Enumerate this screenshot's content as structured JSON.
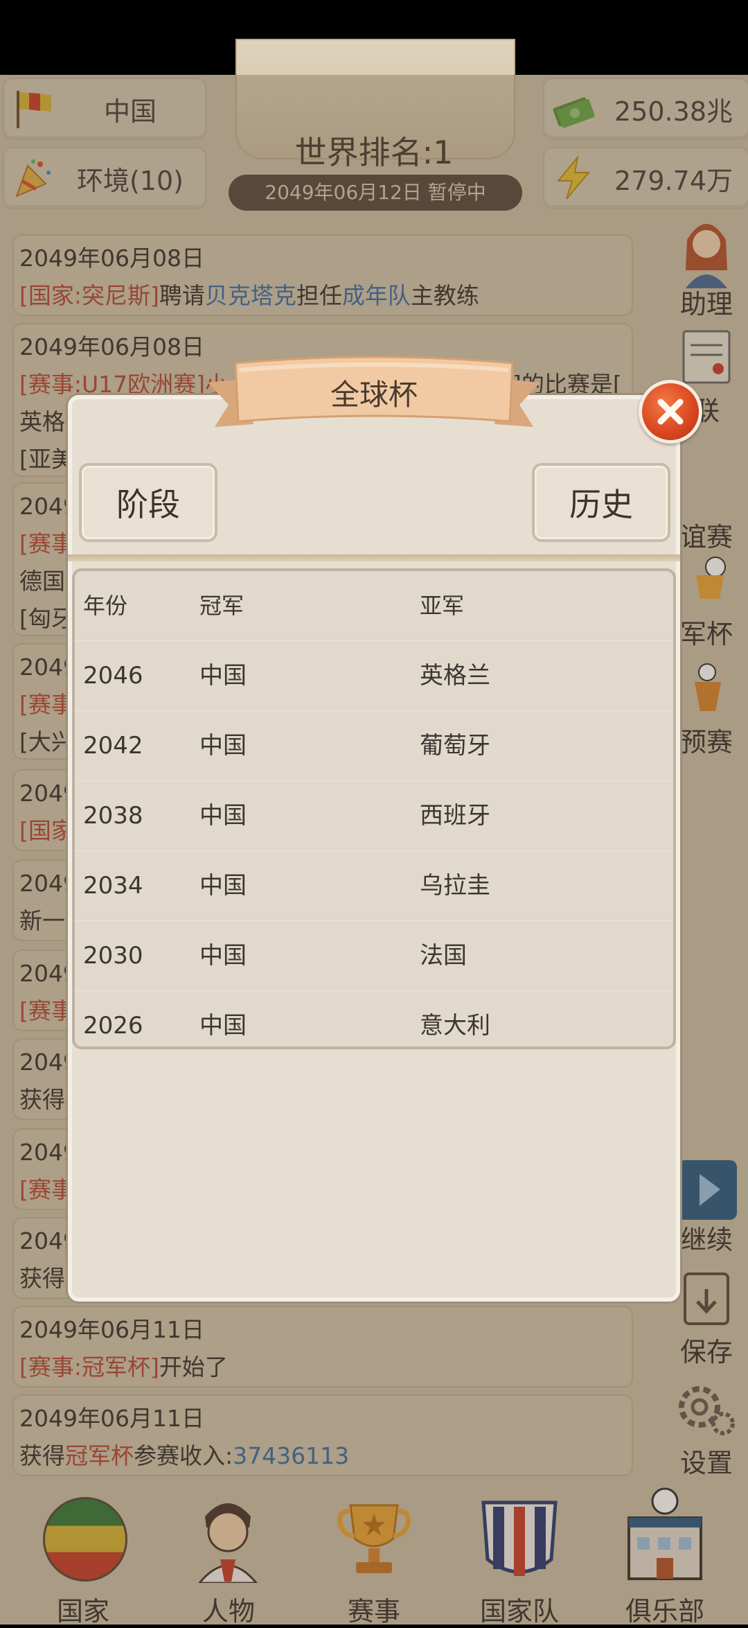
{
  "topbar": {
    "country": "中国",
    "environment": "环境(10)",
    "rank": "世界排名:1",
    "date_status": "2049年06月12日 暂停中",
    "money": "250.38兆",
    "energy": "279.74万"
  },
  "news": [
    {
      "date": "2049年06月08日",
      "line2": "[国家:突尼斯]聘请贝克塔克担任成年队主教练"
    },
    {
      "date": "2049年06月08日",
      "line2": "[赛事:U17欧洲赛]小",
      "line2b": "]的比赛是[",
      "line3": "英格",
      "line4": "[亚美"
    },
    {
      "date": "2049",
      "line2": "[赛事",
      "line3": "德国",
      "line4": "[匈牙"
    },
    {
      "date": "2049",
      "line2": "[赛事",
      "line3": "[大兴"
    },
    {
      "date": "2049",
      "line2": "[国家"
    },
    {
      "date": "2049",
      "line2": "新一"
    },
    {
      "date": "2049",
      "line2": "[赛事"
    },
    {
      "date": "2049",
      "line2": "获得"
    },
    {
      "date": "2049",
      "line2": "[赛事"
    },
    {
      "date": "2049",
      "line2": "获得"
    },
    {
      "date": "2049年06月11日",
      "line2_red": "[赛事:冠军杯]",
      "line2_rest": "开始了"
    },
    {
      "date": "2049年06月11日",
      "line2_a": "获得",
      "line2_red": "冠军杯",
      "line2_b": "参赛收入:",
      "line2_blue": "37436113"
    }
  ],
  "news_fragments": {
    "n1_country": "[国家:突尼斯]",
    "n1_a": "聘请",
    "n1_person": "贝克塔克",
    "n1_b": "担任",
    "n1_team": "成年队",
    "n1_c": "主教练"
  },
  "side": {
    "assistant": "助理",
    "friendly_partial": "谊赛",
    "cup_partial": "军杯",
    "qual_partial": "预赛",
    "continue_partial": "继续",
    "save": "保存",
    "settings": "设置",
    "top_partial": "联"
  },
  "nav": {
    "country": "国家",
    "people": "人物",
    "events": "赛事",
    "national_team": "国家队",
    "club": "俱乐部"
  },
  "dialog": {
    "title": "全球杯",
    "tab_stage": "阶段",
    "tab_history": "历史",
    "headers": [
      "年份",
      "冠军",
      "亚军"
    ],
    "rows": [
      [
        "2046",
        "中国",
        "英格兰"
      ],
      [
        "2042",
        "中国",
        "葡萄牙"
      ],
      [
        "2038",
        "中国",
        "西班牙"
      ],
      [
        "2034",
        "中国",
        "乌拉圭"
      ],
      [
        "2030",
        "中国",
        "法国"
      ],
      [
        "2026",
        "中国",
        "意大利"
      ]
    ]
  },
  "colors": {
    "accent_red": "#b64a3b",
    "accent_blue": "#3d6fa8",
    "close_button": "#d8451f"
  },
  "icons": [
    "flag-icon",
    "party-popper-icon",
    "money-icon",
    "lightning-icon",
    "close-icon",
    "assistant-icon",
    "save-icon",
    "gear-icon",
    "globe-icon",
    "person-icon",
    "trophy-icon",
    "jersey-icon",
    "club-building-icon"
  ]
}
